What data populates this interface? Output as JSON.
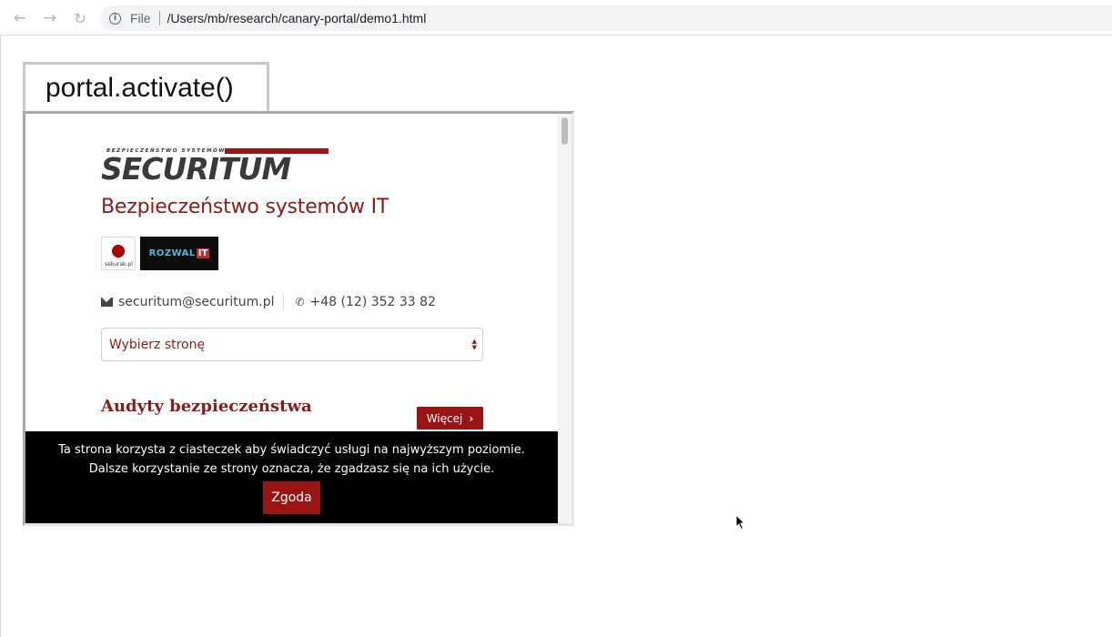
{
  "browser": {
    "back_icon": "arrow-left-icon",
    "forward_icon": "arrow-right-icon",
    "reload_icon": "reload-icon",
    "scheme": "File",
    "url": "/Users/mb/research/canary-portal/demo1.html"
  },
  "page": {
    "activate_label": "portal.activate()"
  },
  "portal": {
    "logo_small": "BEZPIECZEŃSTWO SYSTEMÓW IT",
    "logo_text": "SECURITUM",
    "tagline": "Bezpieczeństwo systemów IT",
    "badges": {
      "sekurak": "sekurak.pl",
      "rozwal": "ROZWAL",
      "rozwal_num": "IT"
    },
    "contact": {
      "email": "securitum@securitum.pl",
      "phone": "+48 (12) 352 33 82"
    },
    "select": {
      "value": "Wybierz stronę"
    },
    "section": {
      "title": "Audyty bezpieczeństwa",
      "more_label": "Więcej"
    },
    "cookie": {
      "text": "Ta strona korzysta z ciasteczek aby świadczyć usługi na najwyższym poziomie. Dalsze korzystanie ze strony oznacza, że zgadzasz się na ich użycie.",
      "accept_label": "Zgoda"
    }
  },
  "colors": {
    "brand": "#8b1a1a",
    "button": "#9b1414"
  }
}
